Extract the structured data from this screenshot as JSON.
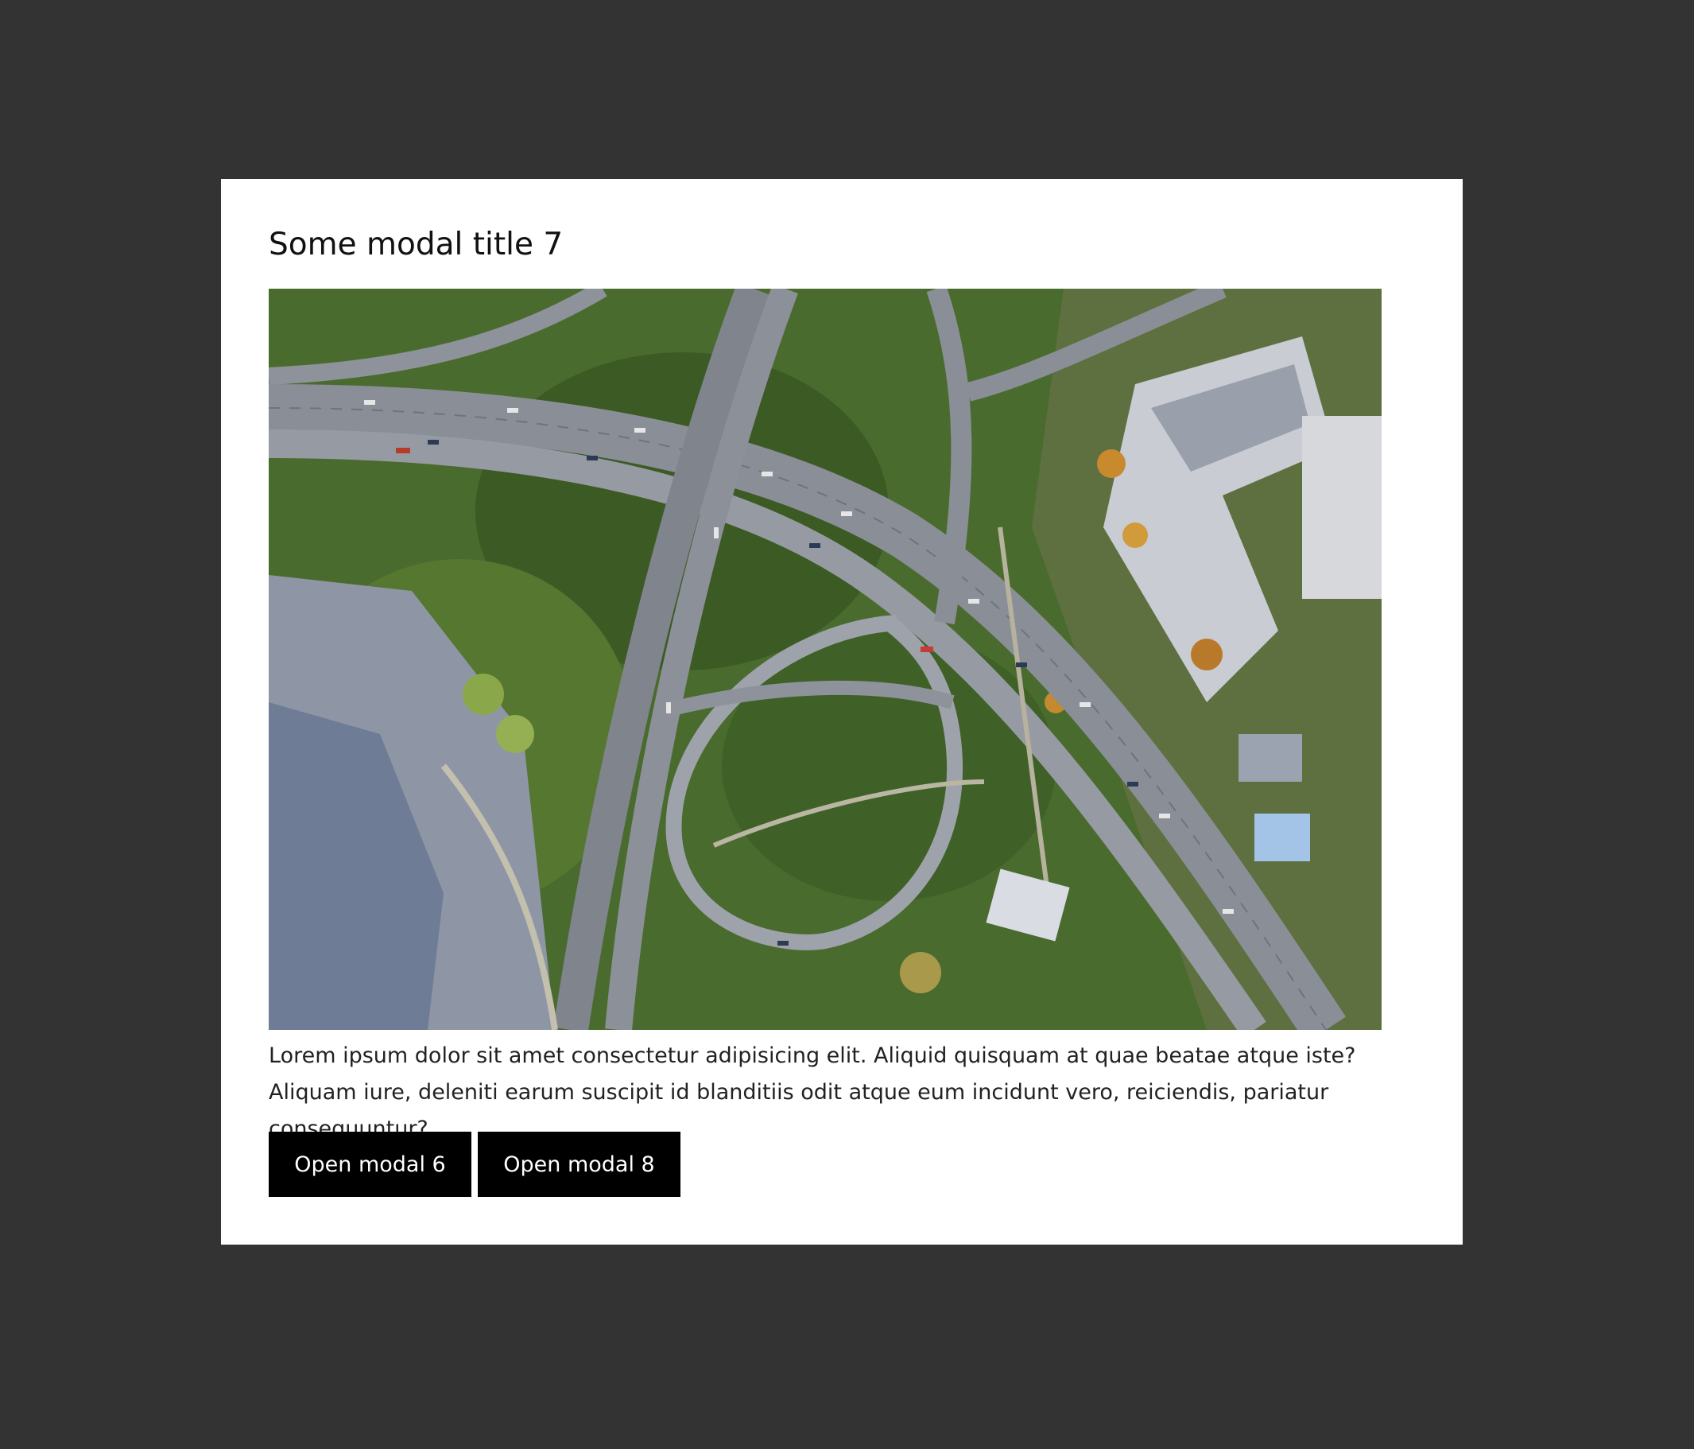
{
  "modal": {
    "title": "Some modal title 7",
    "image": {
      "icon": "aerial-highway-interchange-photo"
    },
    "body_text": "Lorem ipsum dolor sit amet consectetur adipisicing elit. Aliquid quisquam at quae beatae atque iste? Aliquam iure, deleniti earum suscipit id blanditiis odit atque eum incidunt vero, reiciendis, pariatur consequuntur?",
    "buttons": [
      {
        "label": "Open modal 6"
      },
      {
        "label": "Open modal 8"
      }
    ]
  },
  "colors": {
    "backdrop": "#333333",
    "modal_background": "#ffffff",
    "button_background": "#000000",
    "button_text": "#ffffff"
  }
}
